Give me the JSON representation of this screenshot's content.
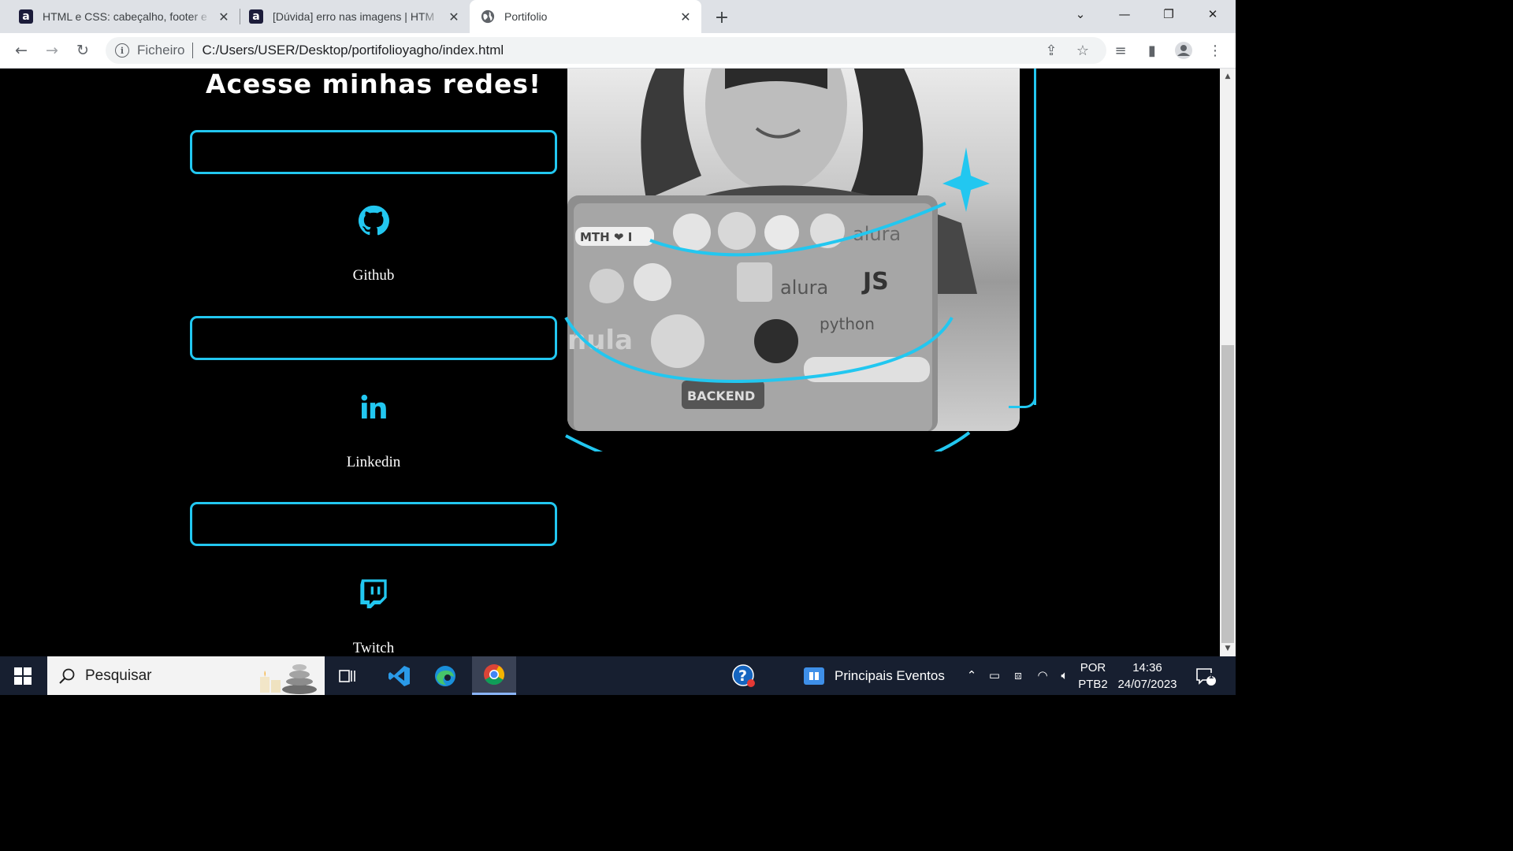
{
  "browser": {
    "tabs": [
      {
        "title": "HTML e CSS: cabeçalho, footer e",
        "favicon": "alura-icon"
      },
      {
        "title": "[Dúvida] erro nas imagens | HTM",
        "favicon": "alura-icon"
      },
      {
        "title": "Portifolio",
        "favicon": "globe-icon"
      }
    ],
    "address": {
      "scheme_label": "Ficheiro",
      "url": "C:/Users/USER/Desktop/portifolioyagho/index.html"
    }
  },
  "page": {
    "heading": "Acesse minhas redes!",
    "socials": [
      {
        "label": "Github",
        "icon": "github-icon"
      },
      {
        "label": "Linkedin",
        "icon": "linkedin-icon"
      },
      {
        "label": "Twitch",
        "icon": "twitch-icon"
      }
    ],
    "accent_color": "#22c7f0"
  },
  "taskbar": {
    "search_placeholder": "Pesquisar",
    "events_label": "Principais Eventos",
    "lang_top": "POR",
    "lang_bottom": "PTB2",
    "time": "14:36",
    "date": "24/07/2023",
    "notification_count": "1"
  }
}
